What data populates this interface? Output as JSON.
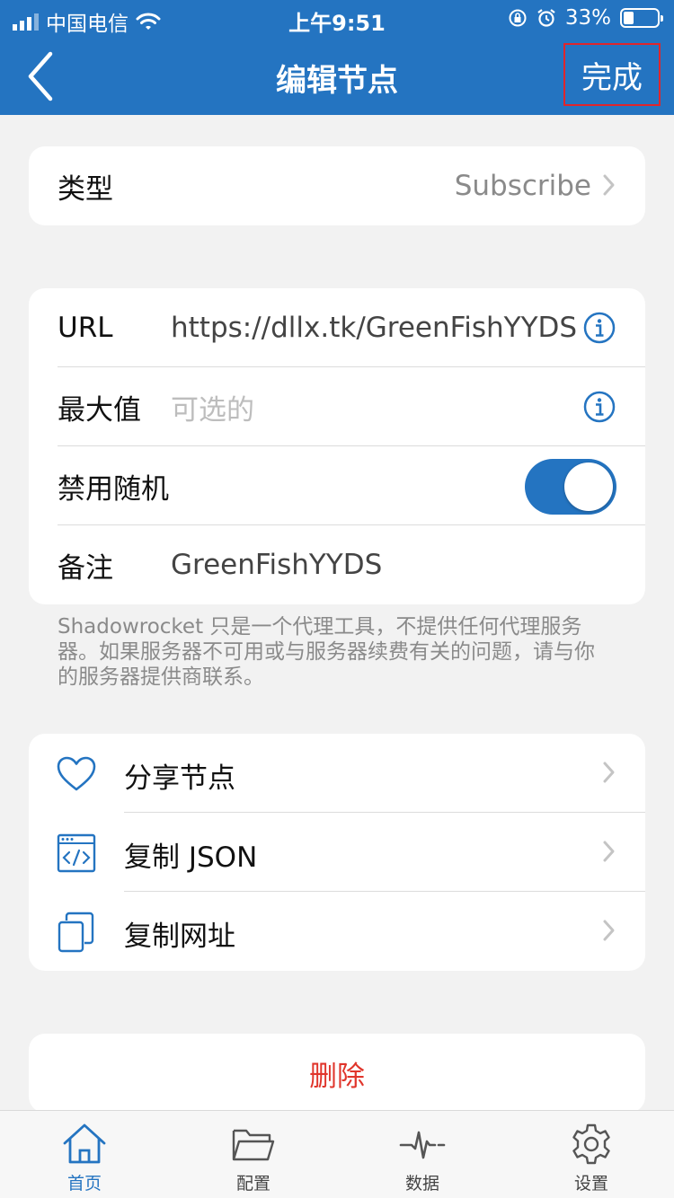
{
  "status_bar": {
    "carrier": "中国电信",
    "time": "上午9:51",
    "battery": "33%"
  },
  "nav": {
    "title": "编辑节点",
    "done_label": "完成"
  },
  "type_row": {
    "label": "类型",
    "value": "Subscribe"
  },
  "form": {
    "url_label": "URL",
    "url_value": "https://dllx.tk/GreenFishYYDS",
    "max_label": "最大值",
    "max_placeholder": "可选的",
    "random_label": "禁用随机",
    "random_enabled": true,
    "note_label": "备注",
    "note_value": "GreenFishYYDS"
  },
  "disclaimer": "Shadowrocket 只是一个代理工具，不提供任何代理服务器。如果服务器不可用或与服务器续费有关的问题，请与你的服务器提供商联系。",
  "actions": {
    "share": "分享节点",
    "copy_json": "复制 JSON",
    "copy_url": "复制网址"
  },
  "delete_label": "删除",
  "tabbar": {
    "home": "首页",
    "config": "配置",
    "data": "数据",
    "settings": "设置"
  },
  "colors": {
    "accent": "#2474c1",
    "danger": "#e0352b",
    "highlight_box": "#e0252b"
  }
}
